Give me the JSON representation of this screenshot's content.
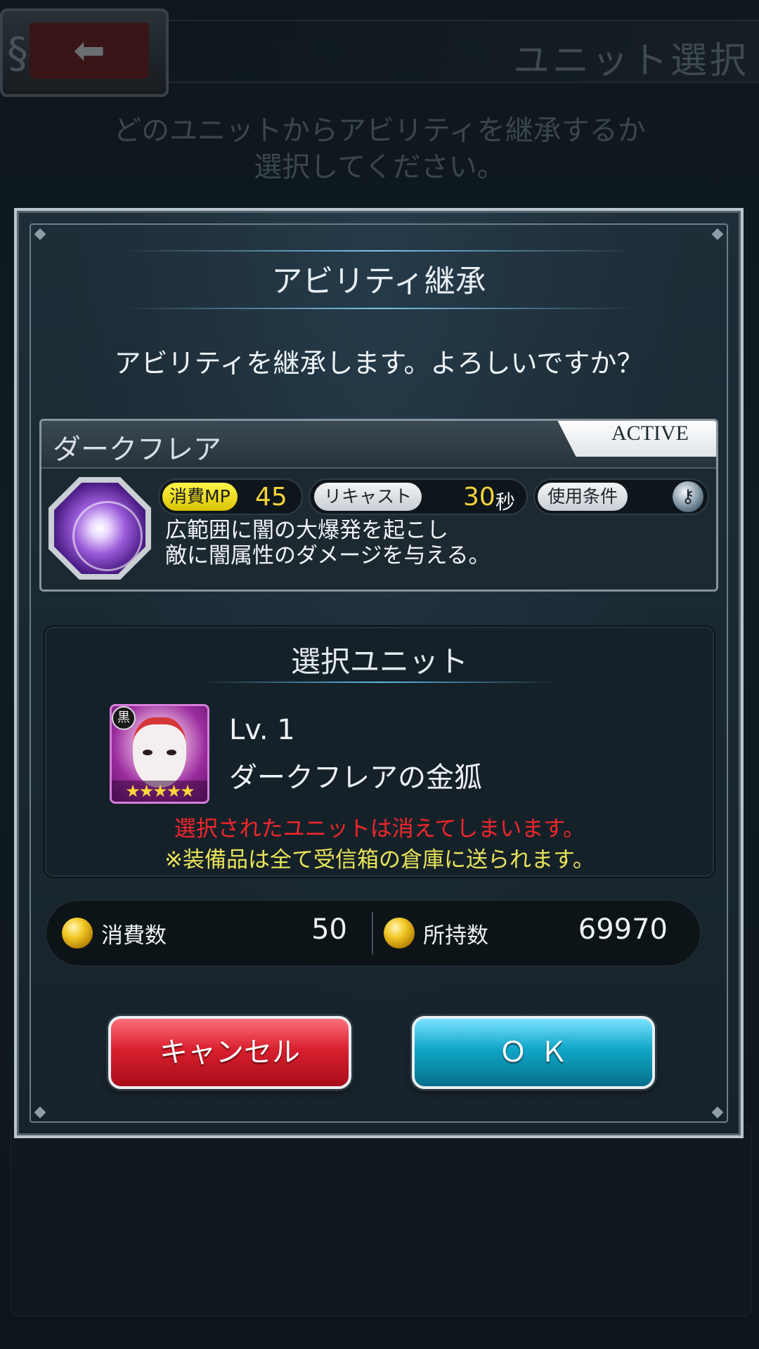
{
  "background": {
    "back_icon": "arrow-left-icon",
    "title": "ユニット選択",
    "instruction": "どのユニットからアビリティを継承するか\n選択してください。"
  },
  "dialog": {
    "title": "アビリティ継承",
    "message": "アビリティを継承します。よろしいですか？",
    "ability": {
      "name": "ダークフレア",
      "type": "ACTIVE",
      "mp_label": "消費MP",
      "mp_value": "45",
      "recast_label": "リキャスト",
      "recast_value": "30",
      "recast_unit": "秒",
      "condition_label": "使用条件",
      "condition_icon": "key-icon",
      "description": "広範囲に闇の大爆発を起こし\n敵に闇属性のダメージを与える。",
      "icon": "dark-flare-icon"
    },
    "unit": {
      "section_title": "選択ユニット",
      "element": "黒",
      "stars": "★★★★★",
      "level": "Lv. 1",
      "name": "ダークフレアの金狐",
      "warning": "選択されたユニットは消えてしまいます。",
      "note": "※装備品は全て受信箱の倉庫に送られます。"
    },
    "currency": {
      "icon": "gold-coin-icon",
      "cost_label": "消費数",
      "cost_value": "50",
      "owned_label": "所持数",
      "owned_value": "69970"
    },
    "buttons": {
      "cancel": "キャンセル",
      "ok": "ＯＫ"
    }
  },
  "colors": {
    "warning_red": "#f2262d",
    "note_yellow": "#e9e45a",
    "value_yellow": "#f3d43b",
    "cancel_red": "#d9202e",
    "ok_cyan": "#10a6c8"
  }
}
